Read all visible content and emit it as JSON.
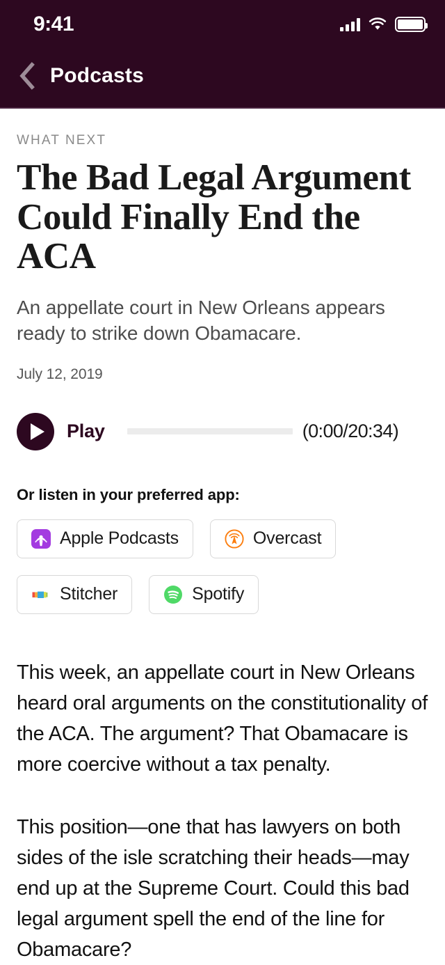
{
  "status_bar": {
    "time": "9:41",
    "signal_icon": "cellular-signal-icon",
    "wifi_icon": "wifi-icon",
    "battery_icon": "battery-full-icon"
  },
  "nav": {
    "back_icon": "chevron-left-icon",
    "title": "Podcasts"
  },
  "article": {
    "kicker": "WHAT NEXT",
    "headline": "The Bad Legal Argument Could Finally End the ACA",
    "dek": "An appellate court in New Orleans appears ready to strike down Obamacare.",
    "date": "July 12, 2019"
  },
  "player": {
    "play_icon": "play-icon",
    "play_label": "Play",
    "timecode": "(0:00/20:34)",
    "current_time": "0:00",
    "duration": "20:34",
    "progress_percent": 0
  },
  "app_links": {
    "heading": "Or listen in your preferred app:",
    "items": [
      {
        "label": "Apple Podcasts",
        "icon": "apple-podcasts-icon",
        "color": "#9B3FD4"
      },
      {
        "label": "Overcast",
        "icon": "overcast-icon",
        "color": "#FC7E0F"
      },
      {
        "label": "Stitcher",
        "icon": "stitcher-icon",
        "color": "#39A9DB"
      },
      {
        "label": "Spotify",
        "icon": "spotify-icon",
        "color": "#4FD967"
      }
    ]
  },
  "body": {
    "paragraphs": [
      "This week, an appellate court in New Orleans heard oral arguments on the constitutionality of the ACA. The argument? That Obamacare is more coercive without a tax penalty.",
      "This position—one that has lawyers on both sides of the isle scratching their heads—may end up at the Supreme Court. Could this bad legal argument spell the end of the line for Obamacare?"
    ]
  },
  "theme": {
    "header_background": "#2D0820",
    "accent": "#2D0820",
    "page_background": "#ffffff",
    "progress_track": "#ececec"
  }
}
